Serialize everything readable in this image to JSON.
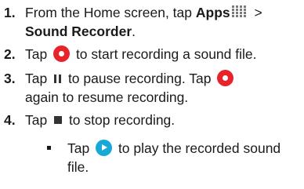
{
  "steps": [
    {
      "num": "1.",
      "line1_pre": "From the Home screen, tap ",
      "apps_label": "Apps",
      "gt": " >",
      "line2_bold": "Sound Recorder",
      "line2_end": "."
    },
    {
      "num": "2.",
      "pre": "Tap ",
      "post": " to start recording a sound file."
    },
    {
      "num": "3.",
      "pre": "Tap ",
      "mid": " to pause recording. Tap ",
      "line2": "again to resume recording."
    },
    {
      "num": "4.",
      "pre": "Tap ",
      "post": " to stop recording."
    }
  ],
  "bullet": {
    "pre": "Tap ",
    "post": " to play the recorded sound",
    "line2": "file."
  },
  "icons": {
    "record": "record-icon",
    "apps": "apps-grid-icon",
    "pause": "pause-icon",
    "stop": "stop-icon",
    "play": "play-icon",
    "record_color": "#e8242b",
    "play_color": "#18a8d8"
  }
}
